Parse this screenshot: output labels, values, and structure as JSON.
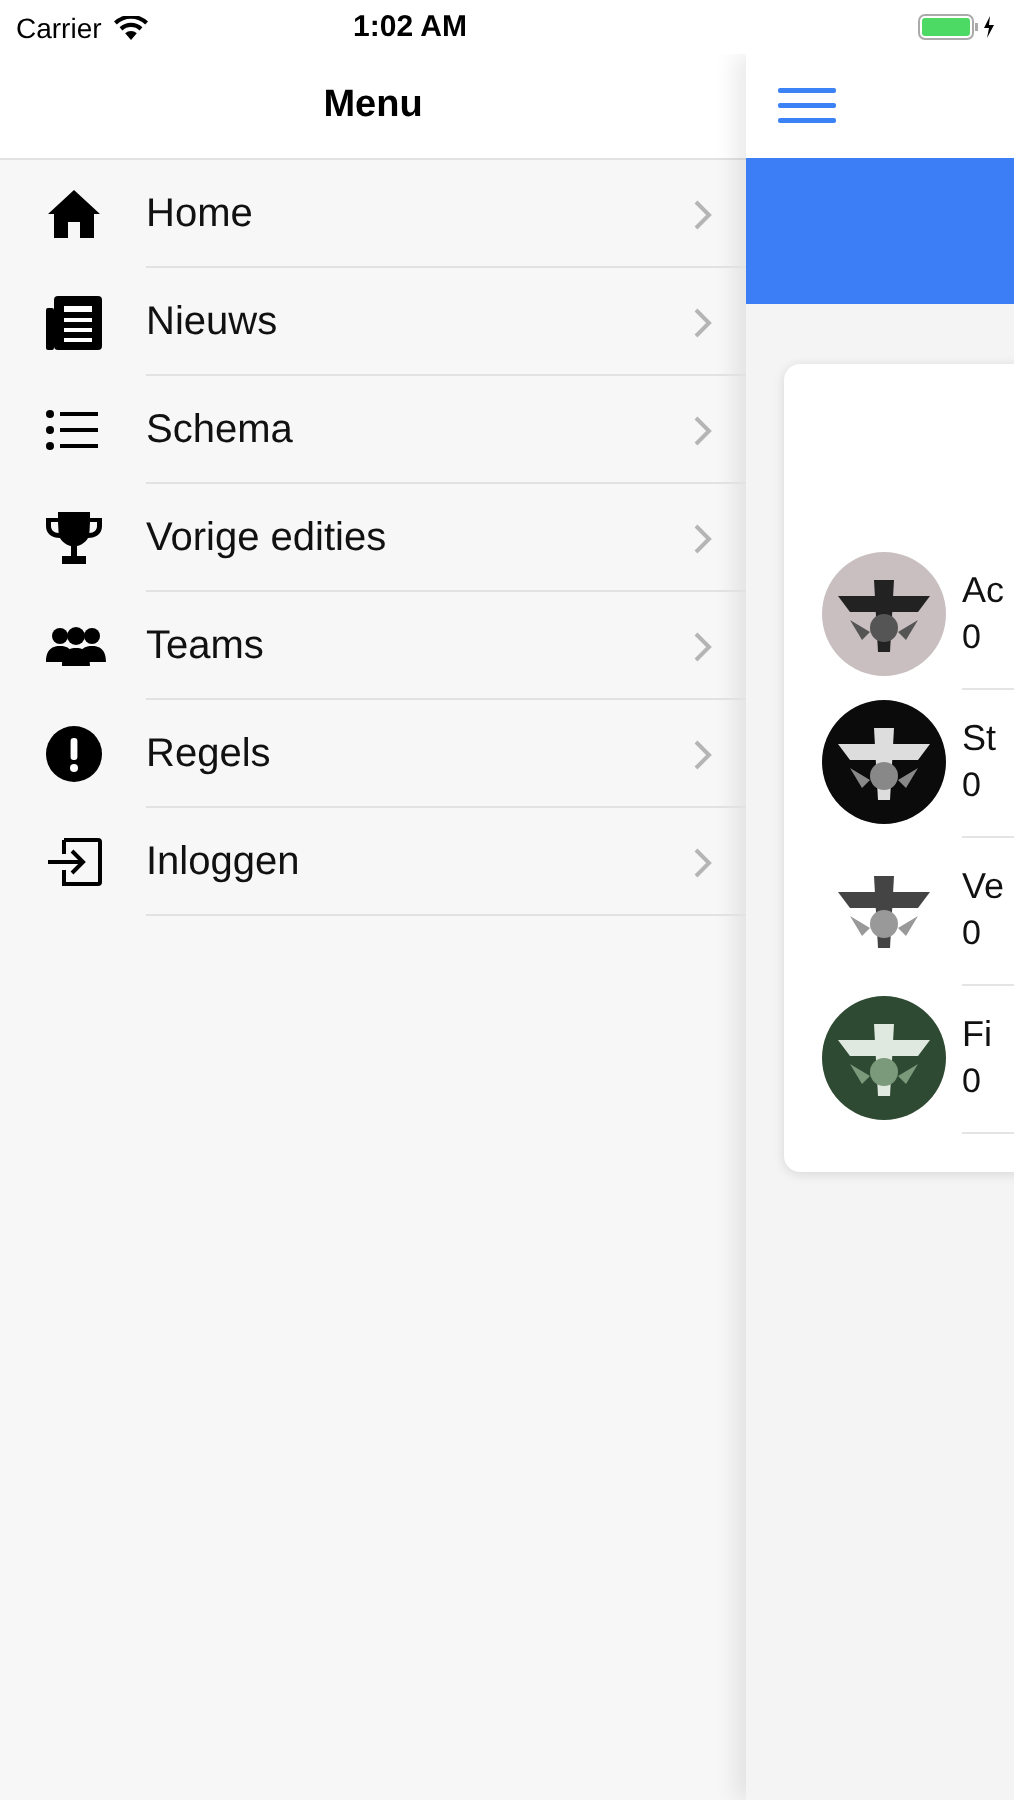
{
  "status_bar": {
    "carrier": "Carrier",
    "time": "1:02 AM"
  },
  "menu": {
    "title": "Menu",
    "items": [
      {
        "label": "Home",
        "kind": "home"
      },
      {
        "label": "Nieuws",
        "kind": "news"
      },
      {
        "label": "Schema",
        "kind": "list"
      },
      {
        "label": "Vorige edities",
        "kind": "trophy"
      },
      {
        "label": "Teams",
        "kind": "people"
      },
      {
        "label": "Regels",
        "kind": "alert"
      },
      {
        "label": "Inloggen",
        "kind": "login"
      }
    ]
  },
  "main": {
    "teams": [
      {
        "name": "Ac",
        "score": "0"
      },
      {
        "name": "St",
        "score": "0"
      },
      {
        "name": "Ve",
        "score": "0"
      },
      {
        "name": "Fi",
        "score": "0"
      }
    ]
  }
}
